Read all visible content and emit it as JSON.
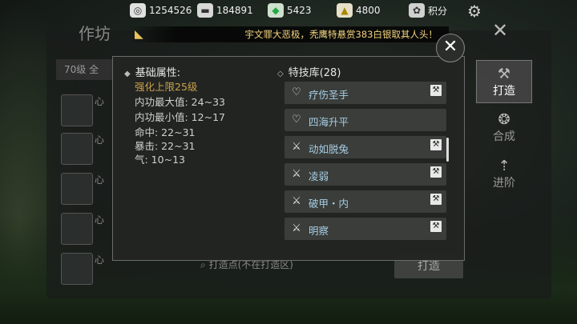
{
  "resources": [
    {
      "icon": "film-reel-icon",
      "value": "1254526"
    },
    {
      "icon": "ingot-icon",
      "value": "184891"
    },
    {
      "icon": "jade-icon",
      "value": "5423"
    },
    {
      "icon": "gold-ingot-icon",
      "value": "4800"
    },
    {
      "icon": "points-icon",
      "value": "积分"
    }
  ],
  "announcement": "宇文罪大恶极，秃鹰特悬赏383白银取其人头！",
  "background_window": {
    "title": "作坊",
    "level_filter": "70级  全",
    "item_prefix": "心",
    "side_tabs": [
      {
        "label": "打造",
        "icon": "anvil-icon"
      },
      {
        "label": "合成",
        "icon": "compose-icon"
      },
      {
        "label": "进阶",
        "icon": "advance-icon"
      }
    ],
    "search_placeholder": "打造点(不在打造区)",
    "craft_button": "打造"
  },
  "popup": {
    "attributes_title": "基础属性:",
    "enhance_limit": "强化上限25级",
    "attributes": [
      "内功最大值: 24~33",
      "内功最小值: 12~17",
      "命中: 22~31",
      "暴击: 22~31",
      "气: 10~13"
    ],
    "skills_title": "特技库(28)",
    "skills": [
      {
        "name": "疗伤圣手",
        "icon": "heart-plus-icon"
      },
      {
        "name": "四海升平",
        "icon": "heart-plus-icon"
      },
      {
        "name": "动如脱兔",
        "icon": "sword-icon"
      },
      {
        "name": "凌弱",
        "icon": "sword-icon"
      },
      {
        "name": "破甲・内",
        "icon": "sword-icon"
      },
      {
        "name": "明察",
        "icon": "sword-icon"
      }
    ]
  },
  "colors": {
    "accent_gold": "#c9a24a",
    "skill_name": "#a8cfe6",
    "announce": "#f2d37e"
  }
}
